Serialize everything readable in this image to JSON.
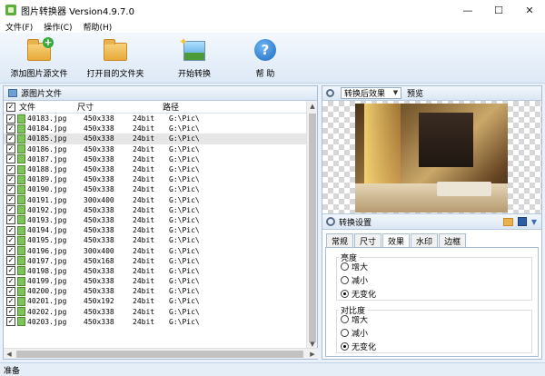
{
  "window": {
    "title": "图片转换器 Version4.9.7.0",
    "minimize": "—",
    "maximize": "☐",
    "close": "✕"
  },
  "menu": {
    "items": [
      "文件(F)",
      "操作(C)",
      "帮助(H)"
    ]
  },
  "toolbar": {
    "add_label": "添加图片源文件",
    "open_label": "打开目的文件夹",
    "convert_label": "开始转换",
    "help_label": "帮 助"
  },
  "source_panel": {
    "title": "源图片文件",
    "headers": {
      "name": "文件",
      "size": "尺寸",
      "path": "路径"
    },
    "rows": [
      {
        "name": "40183.jpg",
        "size": "450x338",
        "bits": "24bit",
        "path": "G:\\Pic\\"
      },
      {
        "name": "40184.jpg",
        "size": "450x338",
        "bits": "24bit",
        "path": "G:\\Pic\\"
      },
      {
        "name": "40185.jpg",
        "size": "450x338",
        "bits": "24bit",
        "path": "G:\\Pic\\"
      },
      {
        "name": "40186.jpg",
        "size": "450x338",
        "bits": "24bit",
        "path": "G:\\Pic\\"
      },
      {
        "name": "40187.jpg",
        "size": "450x338",
        "bits": "24bit",
        "path": "G:\\Pic\\"
      },
      {
        "name": "40188.jpg",
        "size": "450x338",
        "bits": "24bit",
        "path": "G:\\Pic\\"
      },
      {
        "name": "40189.jpg",
        "size": "450x338",
        "bits": "24bit",
        "path": "G:\\Pic\\"
      },
      {
        "name": "40190.jpg",
        "size": "450x338",
        "bits": "24bit",
        "path": "G:\\Pic\\"
      },
      {
        "name": "40191.jpg",
        "size": "300x400",
        "bits": "24bit",
        "path": "G:\\Pic\\"
      },
      {
        "name": "40192.jpg",
        "size": "450x338",
        "bits": "24bit",
        "path": "G:\\Pic\\"
      },
      {
        "name": "40193.jpg",
        "size": "450x338",
        "bits": "24bit",
        "path": "G:\\Pic\\"
      },
      {
        "name": "40194.jpg",
        "size": "450x338",
        "bits": "24bit",
        "path": "G:\\Pic\\"
      },
      {
        "name": "40195.jpg",
        "size": "450x338",
        "bits": "24bit",
        "path": "G:\\Pic\\"
      },
      {
        "name": "40196.jpg",
        "size": "300x400",
        "bits": "24bit",
        "path": "G:\\Pic\\"
      },
      {
        "name": "40197.jpg",
        "size": "450x168",
        "bits": "24bit",
        "path": "G:\\Pic\\"
      },
      {
        "name": "40198.jpg",
        "size": "450x338",
        "bits": "24bit",
        "path": "G:\\Pic\\"
      },
      {
        "name": "40199.jpg",
        "size": "450x338",
        "bits": "24bit",
        "path": "G:\\Pic\\"
      },
      {
        "name": "40200.jpg",
        "size": "450x338",
        "bits": "24bit",
        "path": "G:\\Pic\\"
      },
      {
        "name": "40201.jpg",
        "size": "450x192",
        "bits": "24bit",
        "path": "G:\\Pic\\"
      },
      {
        "name": "40202.jpg",
        "size": "450x338",
        "bits": "24bit",
        "path": "G:\\Pic\\"
      },
      {
        "name": "40203.jpg",
        "size": "450x338",
        "bits": "24bit",
        "path": "G:\\Pic\\"
      }
    ],
    "selected_index": 2
  },
  "preview": {
    "mode_selected": "转换后效果",
    "preview_label": "预览"
  },
  "settings": {
    "title": "转换设置",
    "tabs": [
      "常规",
      "尺寸",
      "效果",
      "水印",
      "边框"
    ],
    "active_tab": "效果",
    "brightness": {
      "title": "亮度",
      "options": [
        "增大",
        "减小",
        "无变化"
      ],
      "selected": "无变化"
    },
    "contrast": {
      "title": "对比度",
      "options": [
        "增大",
        "减小",
        "无变化"
      ],
      "selected": "无变化"
    }
  },
  "status": {
    "text": "准备"
  }
}
